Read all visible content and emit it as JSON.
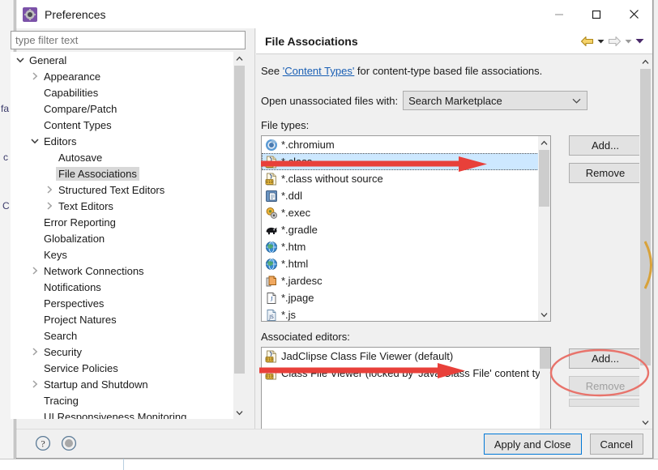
{
  "window": {
    "title": "Preferences",
    "icon": "preferences-gear-icon",
    "controls": {
      "minimize": "minimize-icon",
      "maximize": "maximize-icon",
      "close": "close-icon"
    }
  },
  "sidebar": {
    "filter": {
      "placeholder": "type filter text",
      "value": ""
    },
    "items": [
      {
        "label": "General",
        "level": 0,
        "twisty": "expanded",
        "selected": false
      },
      {
        "label": "Appearance",
        "level": 1,
        "twisty": "collapsed",
        "selected": false
      },
      {
        "label": "Capabilities",
        "level": 1,
        "twisty": "none",
        "selected": false
      },
      {
        "label": "Compare/Patch",
        "level": 1,
        "twisty": "none",
        "selected": false
      },
      {
        "label": "Content Types",
        "level": 1,
        "twisty": "none",
        "selected": false
      },
      {
        "label": "Editors",
        "level": 1,
        "twisty": "expanded",
        "selected": false
      },
      {
        "label": "Autosave",
        "level": 2,
        "twisty": "none",
        "selected": false
      },
      {
        "label": "File Associations",
        "level": 2,
        "twisty": "none",
        "selected": true
      },
      {
        "label": "Structured Text Editors",
        "level": 2,
        "twisty": "collapsed",
        "selected": false
      },
      {
        "label": "Text Editors",
        "level": 2,
        "twisty": "collapsed",
        "selected": false
      },
      {
        "label": "Error Reporting",
        "level": 1,
        "twisty": "none",
        "selected": false
      },
      {
        "label": "Globalization",
        "level": 1,
        "twisty": "none",
        "selected": false
      },
      {
        "label": "Keys",
        "level": 1,
        "twisty": "none",
        "selected": false
      },
      {
        "label": "Network Connections",
        "level": 1,
        "twisty": "collapsed",
        "selected": false
      },
      {
        "label": "Notifications",
        "level": 1,
        "twisty": "none",
        "selected": false
      },
      {
        "label": "Perspectives",
        "level": 1,
        "twisty": "none",
        "selected": false
      },
      {
        "label": "Project Natures",
        "level": 1,
        "twisty": "none",
        "selected": false
      },
      {
        "label": "Search",
        "level": 1,
        "twisty": "none",
        "selected": false
      },
      {
        "label": "Security",
        "level": 1,
        "twisty": "collapsed",
        "selected": false
      },
      {
        "label": "Service Policies",
        "level": 1,
        "twisty": "none",
        "selected": false
      },
      {
        "label": "Startup and Shutdown",
        "level": 1,
        "twisty": "collapsed",
        "selected": false
      },
      {
        "label": "Tracing",
        "level": 1,
        "twisty": "none",
        "selected": false
      },
      {
        "label": "UI Responsiveness Monitoring",
        "level": 1,
        "twisty": "none",
        "selected": false
      }
    ]
  },
  "page": {
    "title": "File Associations",
    "nav": {
      "back": "back-arrow-icon",
      "back_menu": "back-dropdown-icon",
      "forward": "forward-arrow-icon",
      "forward_menu": "forward-dropdown-icon",
      "menu": "view-menu-icon"
    },
    "see_prefix": "See ",
    "see_link": "'Content Types'",
    "see_suffix": " for content-type based file associations.",
    "unassociated_label": "Open unassociated files with:",
    "unassociated_value": "Search Marketplace",
    "file_types_label": "File types:",
    "file_types": [
      {
        "name": "*.chromium",
        "icon": "chromium-icon"
      },
      {
        "name": "*.class",
        "icon": "class-file-icon",
        "selected": true
      },
      {
        "name": "*.class without source",
        "icon": "class-file-icon"
      },
      {
        "name": "*.ddl",
        "icon": "ddl-file-icon"
      },
      {
        "name": "*.exec",
        "icon": "exec-file-icon"
      },
      {
        "name": "*.gradle",
        "icon": "gradle-icon"
      },
      {
        "name": "*.htm",
        "icon": "globe-icon"
      },
      {
        "name": "*.html",
        "icon": "globe-icon"
      },
      {
        "name": "*.jardesc",
        "icon": "jar-icon"
      },
      {
        "name": "*.jpage",
        "icon": "jpage-icon"
      },
      {
        "name": "*.js",
        "icon": "js-file-icon"
      }
    ],
    "file_types_buttons": {
      "add": "Add...",
      "remove": "Remove"
    },
    "associated_editors_label": "Associated editors:",
    "associated_editors": [
      {
        "name": "JadClipse Class File Viewer (default)",
        "icon": "class-file-icon"
      },
      {
        "name": "Class File Viewer (locked by 'Java Class File' content type)",
        "icon": "class-file-icon"
      }
    ],
    "associated_buttons": {
      "add": "Add...",
      "remove": "Remove",
      "remove_disabled": true
    }
  },
  "footer": {
    "help_icon": "help-icon",
    "secondary_icon": "shell-icon",
    "apply_and_close": "Apply and Close",
    "cancel": "Cancel"
  },
  "background_text": {
    "fragment1": "fa",
    "fragment2": "c",
    "fragment3": "C"
  },
  "annotations": {
    "arrow_filetype": "red-arrow-to-class-filetype",
    "arrow_editor": "red-arrow-to-jadclipse-editor",
    "ellipse_add": "red-ellipse-around-add-button",
    "ellipse_right": "red-ellipse-partial-right-edge"
  },
  "colors": {
    "selection_blue": "#cde8ff",
    "link_blue": "#1a5fb4",
    "annotation_red": "#e8403a",
    "focus_blue": "#0078d7",
    "brand_purple": "#7b52a8"
  }
}
